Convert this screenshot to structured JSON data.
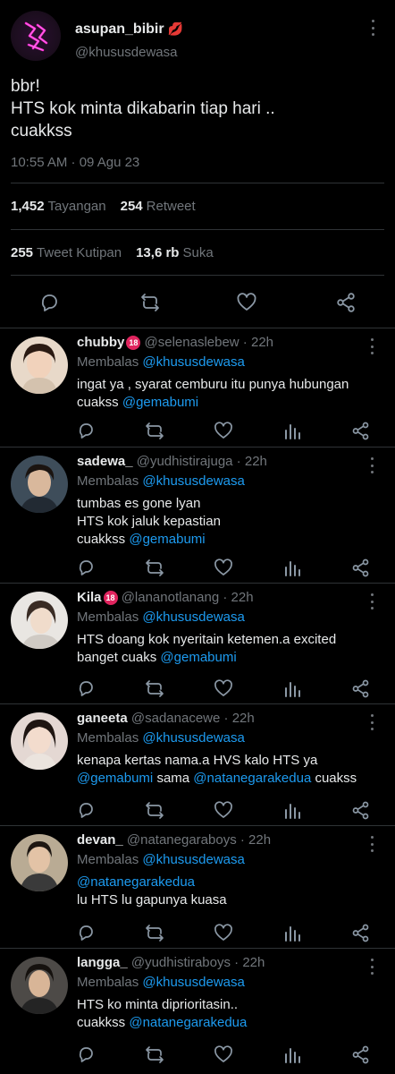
{
  "main_tweet": {
    "display_name": "asupan_bibir",
    "name_emoji": "💋",
    "handle": "@khususdewasa",
    "text": "bbr!\nHTS kok minta dikabarin tiap hari ..\ncuakkss",
    "timestamp": "10:55 AM · 09 Agu 23",
    "stats": {
      "views_value": "1,452",
      "views_label": "Tayangan",
      "retweets_value": "254",
      "retweets_label": "Retweet",
      "quotes_value": "255",
      "quotes_label": "Tweet Kutipan",
      "likes_value": "13,6 rb",
      "likes_label": "Suka"
    }
  },
  "replies": [
    {
      "name": "chubby",
      "badge": "18",
      "handle": "@selenaslebew",
      "time": "22h",
      "replying_label": "Membalas",
      "replying_to": "@khususdewasa",
      "text_plain": "ingat ya , syarat cemburu itu punya hubungan cuakss",
      "text_mention": "@gemabumi",
      "avatar_color": "#c9a58d"
    },
    {
      "name": "sadewa_",
      "badge": "",
      "handle": "@yudhistirajuga",
      "time": "22h",
      "replying_label": "Membalas",
      "replying_to": "@khususdewasa",
      "text_plain": "tumbas es gone lyan\nHTS kok jaluk kepastian\ncuakkss",
      "text_mention": "@gemabumi",
      "avatar_color": "#5d6d7a"
    },
    {
      "name": "Kila",
      "badge": "18",
      "handle": "@lananotlanang",
      "time": "22h",
      "replying_label": "Membalas",
      "replying_to": "@khususdewasa",
      "text_plain": "HTS doang kok nyeritain ketemen.a excited banget cuaks",
      "text_mention": "@gemabumi",
      "avatar_color": "#d8d2cc"
    },
    {
      "name": "ganeeta",
      "badge": "",
      "handle": "@sadanacewe",
      "time": "22h",
      "replying_label": "Membalas",
      "replying_to": "@khususdewasa",
      "text_plain": "kenapa kertas nama.a HVS kalo HTS ya",
      "text_mention": "@gemabumi",
      "text_mid": "sama",
      "text_mention2": "@natanegarakedua",
      "text_tail": "cuakss",
      "avatar_color": "#d9c8c3"
    },
    {
      "name": "devan_",
      "badge": "",
      "handle": "@natanegaraboys",
      "time": "22h",
      "replying_label": "Membalas",
      "replying_to": "@khususdewasa",
      "text_lead_mention": "@natanegarakedua",
      "text_plain": "lu HTS lu gapunya kuasa",
      "avatar_color": "#a89a86"
    },
    {
      "name": "langga_",
      "badge": "",
      "handle": "@yudhistiraboys",
      "time": "22h",
      "replying_label": "Membalas",
      "replying_to": "@khususdewasa",
      "text_plain": "HTS ko minta diprioritasin..\ncuakkss",
      "text_mention": "@natanegarakedua",
      "avatar_color": "#6b6b6b"
    }
  ],
  "colors": {
    "background": "#000000",
    "text": "#e7e9ea",
    "muted": "#71767b",
    "link": "#1d9bf0",
    "divider": "#2f3336",
    "badge": "#e0245e"
  },
  "icons": {
    "reply": "speech-bubble-icon",
    "retweet": "retweet-icon",
    "like": "heart-icon",
    "views": "bar-chart-icon",
    "share": "share-icon",
    "more": "more-vertical-icon"
  }
}
